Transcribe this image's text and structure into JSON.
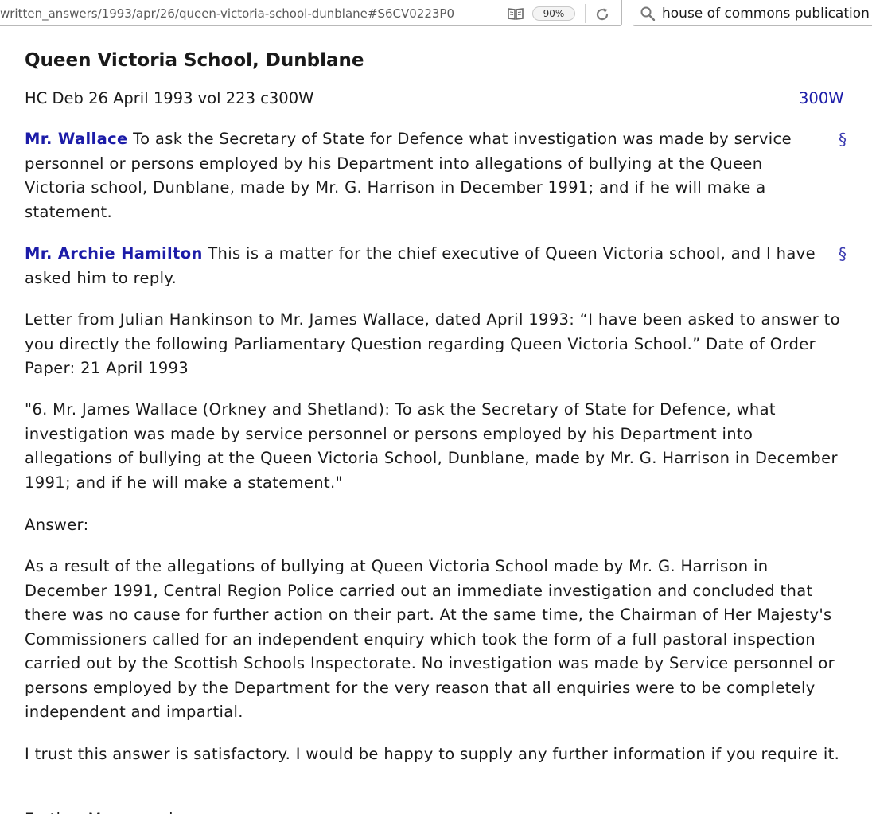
{
  "browser": {
    "url": "written_answers/1993/apr/26/queen-victoria-school-dunblane#S6CV0223P0",
    "zoom": "90%",
    "search_value": "house of commons publications"
  },
  "article": {
    "title": "Queen Victoria School, Dunblane",
    "debate_ref": "HC Deb 26 April 1993 vol 223 c300W",
    "column_ref": "300W",
    "section_mark": "§",
    "paragraphs": [
      {
        "speaker": "Mr. Wallace",
        "text": " To ask the Secretary of State for Defence what investigation was made by service personnel or persons employed by his Department into allegations of bullying at the Queen Victoria school, Dunblane, made by Mr. G. Harrison in December 1991; and if he will make a statement."
      },
      {
        "speaker": "Mr. Archie Hamilton",
        "text": " This is a matter for the chief executive of Queen Victoria school, and I have asked him to reply."
      },
      {
        "text": "Letter from Julian Hankinson to Mr. James Wallace, dated April 1993: “I have been asked to answer to you directly the following Parliamentary Question regarding Queen Victoria School.” Date of Order Paper: 21 April 1993"
      },
      {
        "text": "\"6. Mr. James Wallace (Orkney and Shetland): To ask the Secretary of State for Defence, what investigation was made by service personnel or persons employed by his Department into allegations of bullying at the Queen Victoria School, Dunblane, made by Mr. G. Harrison in December 1991; and if he will make a statement.\""
      },
      {
        "text": "Answer:"
      },
      {
        "text": "As a result of the allegations of bullying at Queen Victoria School made by Mr. G. Harrison in December 1991, Central Region Police carried out an immediate investigation and concluded that there was no cause for further action on their part. At the same time, the Chairman of Her Majesty's Commissioners called for an independent enquiry which took the form of a full pastoral inspection carried out by the Scottish Schools Inspectorate. No investigation was made by Service personnel or persons employed by the Department for the very reason that all enquiries were to be completely independent and impartial."
      },
      {
        "text": "I trust this answer is satisfactory. I would be happy to supply any further information if you require it."
      },
      {
        "text": "Further Memoranda"
      }
    ]
  },
  "colors": {
    "member_link": "#1c1ca8",
    "text": "#1a1a1a"
  },
  "icons": {
    "reader": "reader-view-icon",
    "reload": "reload-icon",
    "search": "search-icon"
  }
}
